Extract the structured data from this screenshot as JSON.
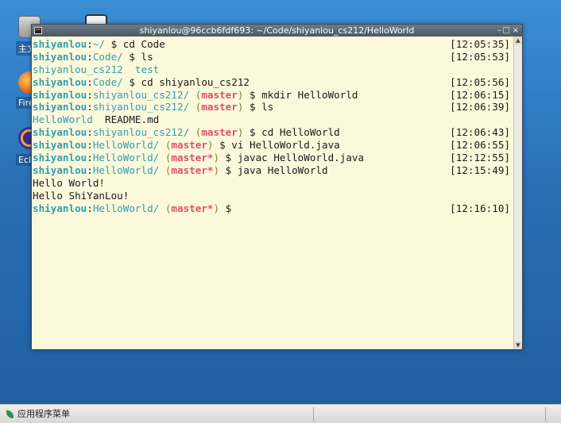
{
  "desktop": {
    "icons": [
      {
        "label": "主文",
        "icon": "home-folder-icon"
      },
      {
        "label": "",
        "icon": "terminal-app-icon"
      },
      {
        "label": "Fire",
        "icon": "firefox-icon"
      },
      {
        "label": "Ecli",
        "icon": "eclipse-icon"
      },
      {
        "label": "",
        "icon": "document-icon"
      }
    ]
  },
  "window": {
    "title": "shiyanlou@96ccb6fdf693: ~/Code/shiyanlou_cs212/HelloWorld",
    "controls": {
      "minimize": "–",
      "maximize": "□",
      "close": "×"
    }
  },
  "terminal": {
    "lines": [
      {
        "segs": [
          {
            "t": "shiyanlou",
            "c": "u"
          },
          {
            "t": ":",
            "c": ""
          },
          {
            "t": "~/",
            "c": "d"
          },
          {
            "t": " $ cd Code",
            "c": ""
          }
        ],
        "ts": "[12:05:35]"
      },
      {
        "segs": [
          {
            "t": "shiyanlou",
            "c": "u"
          },
          {
            "t": ":",
            "c": ""
          },
          {
            "t": "Code/",
            "c": "d"
          },
          {
            "t": " $ ls",
            "c": ""
          }
        ],
        "ts": "[12:05:53]"
      },
      {
        "segs": [
          {
            "t": "shiyanlou_cs212",
            "c": "d"
          },
          {
            "t": "  ",
            "c": ""
          },
          {
            "t": "test",
            "c": "d"
          }
        ],
        "ts": ""
      },
      {
        "segs": [
          {
            "t": "shiyanlou",
            "c": "u"
          },
          {
            "t": ":",
            "c": ""
          },
          {
            "t": "Code/",
            "c": "d"
          },
          {
            "t": " $ cd shiyanlou_cs212",
            "c": ""
          }
        ],
        "ts": "[12:05:56]"
      },
      {
        "segs": [
          {
            "t": "shiyanlou",
            "c": "u"
          },
          {
            "t": ":",
            "c": ""
          },
          {
            "t": "shiyanlou_cs212/",
            "c": "d"
          },
          {
            "t": " (",
            "c": "p"
          },
          {
            "t": "master",
            "c": "b"
          },
          {
            "t": ")",
            "c": "p"
          },
          {
            "t": " $ mkdir HelloWorld",
            "c": ""
          }
        ],
        "ts": "[12:06:15]"
      },
      {
        "segs": [
          {
            "t": "shiyanlou",
            "c": "u"
          },
          {
            "t": ":",
            "c": ""
          },
          {
            "t": "shiyanlou_cs212/",
            "c": "d"
          },
          {
            "t": " (",
            "c": "p"
          },
          {
            "t": "master",
            "c": "b"
          },
          {
            "t": ")",
            "c": "p"
          },
          {
            "t": " $ ls",
            "c": ""
          }
        ],
        "ts": "[12:06:39]"
      },
      {
        "segs": [
          {
            "t": "HelloWorld",
            "c": "d"
          },
          {
            "t": "  README.md",
            "c": ""
          }
        ],
        "ts": ""
      },
      {
        "segs": [
          {
            "t": "shiyanlou",
            "c": "u"
          },
          {
            "t": ":",
            "c": ""
          },
          {
            "t": "shiyanlou_cs212/",
            "c": "d"
          },
          {
            "t": " (",
            "c": "p"
          },
          {
            "t": "master",
            "c": "b"
          },
          {
            "t": ")",
            "c": "p"
          },
          {
            "t": " $ cd HelloWorld",
            "c": ""
          }
        ],
        "ts": "[12:06:43]"
      },
      {
        "segs": [
          {
            "t": "shiyanlou",
            "c": "u"
          },
          {
            "t": ":",
            "c": ""
          },
          {
            "t": "HelloWorld/",
            "c": "d"
          },
          {
            "t": " (",
            "c": "p"
          },
          {
            "t": "master",
            "c": "b"
          },
          {
            "t": ")",
            "c": "p"
          },
          {
            "t": " $ vi HelloWorld.java",
            "c": ""
          }
        ],
        "ts": "[12:06:55]"
      },
      {
        "segs": [
          {
            "t": "shiyanlou",
            "c": "u"
          },
          {
            "t": ":",
            "c": ""
          },
          {
            "t": "HelloWorld/",
            "c": "d"
          },
          {
            "t": " (",
            "c": "p"
          },
          {
            "t": "master*",
            "c": "b"
          },
          {
            "t": ")",
            "c": "p"
          },
          {
            "t": " $ javac HelloWorld.java",
            "c": ""
          }
        ],
        "ts": "[12:12:55]"
      },
      {
        "segs": [
          {
            "t": "shiyanlou",
            "c": "u"
          },
          {
            "t": ":",
            "c": ""
          },
          {
            "t": "HelloWorld/",
            "c": "d"
          },
          {
            "t": " (",
            "c": "p"
          },
          {
            "t": "master*",
            "c": "b"
          },
          {
            "t": ")",
            "c": "p"
          },
          {
            "t": " $ java HelloWorld",
            "c": ""
          }
        ],
        "ts": "[12:15:49]"
      },
      {
        "segs": [
          {
            "t": "Hello World!",
            "c": ""
          }
        ],
        "ts": ""
      },
      {
        "segs": [
          {
            "t": "Hello ShiYanLou!",
            "c": ""
          }
        ],
        "ts": ""
      },
      {
        "segs": [
          {
            "t": "shiyanlou",
            "c": "u"
          },
          {
            "t": ":",
            "c": ""
          },
          {
            "t": "HelloWorld/",
            "c": "d"
          },
          {
            "t": " (",
            "c": "p"
          },
          {
            "t": "master*",
            "c": "b"
          },
          {
            "t": ")",
            "c": "p"
          },
          {
            "t": " $",
            "c": ""
          }
        ],
        "ts": "[12:16:10]"
      }
    ]
  },
  "scrollbar": {
    "up": "▲",
    "down": "▼"
  },
  "taskbar": {
    "menu_label": "应用程序菜单"
  },
  "colors": {
    "user": "#2f9fb0",
    "branch": "#e0506a",
    "paren": "#7a8a2a",
    "terminal_bg": "#fbf8dc"
  }
}
